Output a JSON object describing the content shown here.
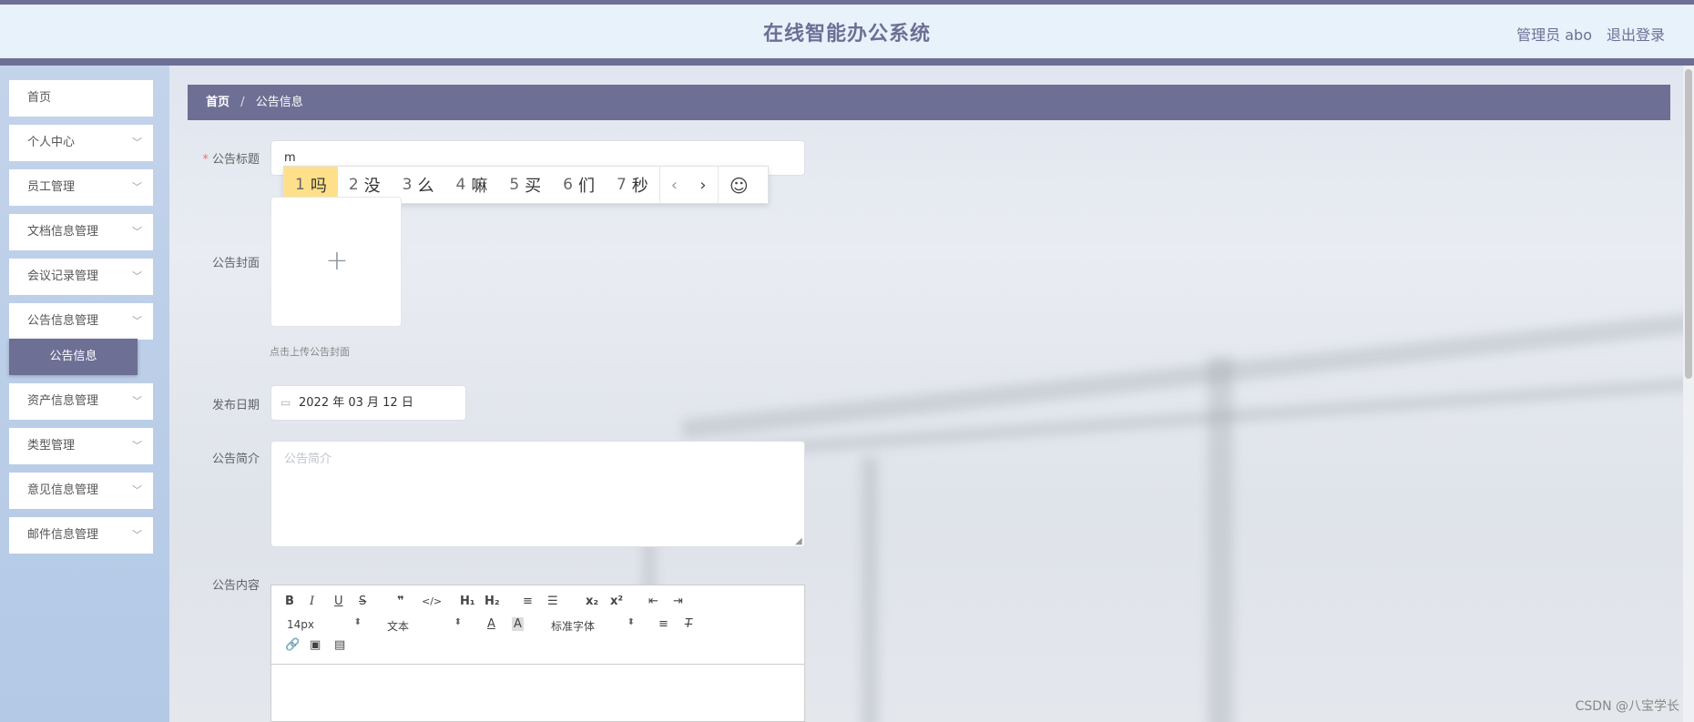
{
  "header": {
    "title": "在线智能办公系统",
    "user": "管理员 abo",
    "logout": "退出登录"
  },
  "sidebar": {
    "items": [
      {
        "label": "首页",
        "expandable": false
      },
      {
        "label": "个人中心",
        "expandable": true
      },
      {
        "label": "员工管理",
        "expandable": true
      },
      {
        "label": "文档信息管理",
        "expandable": true
      },
      {
        "label": "会议记录管理",
        "expandable": true
      },
      {
        "label": "公告信息管理",
        "expandable": true
      },
      {
        "label": "资产信息管理",
        "expandable": true
      },
      {
        "label": "类型管理",
        "expandable": true
      },
      {
        "label": "意见信息管理",
        "expandable": true
      },
      {
        "label": "邮件信息管理",
        "expandable": true
      }
    ],
    "active_sub": "公告信息"
  },
  "breadcrumb": {
    "home": "首页",
    "separator": "/",
    "current": "公告信息"
  },
  "form": {
    "title_label": "公告标题",
    "title_value": "m",
    "required_mark": "*",
    "cover_label": "公告封面",
    "cover_hint": "点击上传公告封面",
    "date_label": "发布日期",
    "date_value": "2022 年 03 月 12 日",
    "summary_label": "公告简介",
    "summary_placeholder": "公告简介",
    "content_label": "公告内容"
  },
  "ime": {
    "candidates": [
      {
        "num": "1",
        "text": "吗"
      },
      {
        "num": "2",
        "text": "没"
      },
      {
        "num": "3",
        "text": "么"
      },
      {
        "num": "4",
        "text": "嘛"
      },
      {
        "num": "5",
        "text": "买"
      },
      {
        "num": "6",
        "text": "们"
      },
      {
        "num": "7",
        "text": "秒"
      }
    ]
  },
  "editor": {
    "row1": [
      "B",
      "I",
      "U",
      "S",
      "❞",
      "</>",
      "H₁",
      "H₂",
      "≡",
      "☰",
      "x₂",
      "x²",
      "⇤",
      "⇥"
    ],
    "font_size": "14px",
    "block_type": "文本",
    "font_family": "标准字体"
  },
  "watermark": "CSDN @八宝学长",
  "colors": {
    "primary": "#6d6f95",
    "header_bg": "#e7f2fb",
    "ime_selected": "#ffe08a"
  }
}
